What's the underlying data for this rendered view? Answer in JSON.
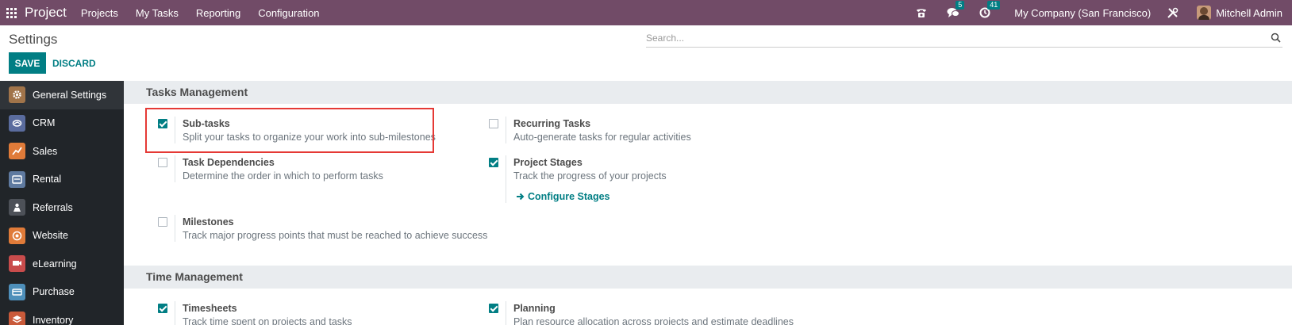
{
  "navbar": {
    "app_name": "Project",
    "menu": [
      "Projects",
      "My Tasks",
      "Reporting",
      "Configuration"
    ],
    "messages_count": "5",
    "activities_count": "41",
    "company": "My Company (San Francisco)",
    "user": "Mitchell Admin",
    "color": "#714b67"
  },
  "control": {
    "title": "Settings",
    "search_placeholder": "Search...",
    "save_label": "SAVE",
    "discard_label": "DISCARD",
    "accent": "#017e84"
  },
  "sidebar": {
    "items": [
      {
        "label": "General Settings",
        "icon": "gear-icon",
        "color": "#a1744a"
      },
      {
        "label": "CRM",
        "icon": "handshake-icon",
        "color": "#5a6c9e"
      },
      {
        "label": "Sales",
        "icon": "chart-icon",
        "color": "#e07b39"
      },
      {
        "label": "Rental",
        "icon": "rental-icon",
        "color": "#5f7aa0"
      },
      {
        "label": "Referrals",
        "icon": "referrals-icon",
        "color": "#4d5158"
      },
      {
        "label": "Website",
        "icon": "globe-icon",
        "color": "#e07b39"
      },
      {
        "label": "eLearning",
        "icon": "elearning-icon",
        "color": "#c94c4c"
      },
      {
        "label": "Purchase",
        "icon": "purchase-icon",
        "color": "#4e8fba"
      },
      {
        "label": "Inventory",
        "icon": "inventory-icon",
        "color": "#c95a3a"
      }
    ]
  },
  "sections": {
    "tasks": {
      "title": "Tasks Management",
      "subtasks": {
        "title": "Sub-tasks",
        "desc": "Split your tasks to organize your work into sub-milestones",
        "checked": true
      },
      "recurring": {
        "title": "Recurring Tasks",
        "desc": "Auto-generate tasks for regular activities",
        "checked": false
      },
      "dependencies": {
        "title": "Task Dependencies",
        "desc": "Determine the order in which to perform tasks",
        "checked": false
      },
      "stages": {
        "title": "Project Stages",
        "desc": "Track the progress of your projects",
        "checked": true,
        "link": "Configure Stages"
      },
      "milestones": {
        "title": "Milestones",
        "desc": "Track major progress points that must be reached to achieve success",
        "checked": false
      }
    },
    "time": {
      "title": "Time Management",
      "timesheets": {
        "title": "Timesheets",
        "desc": "Track time spent on projects and tasks",
        "checked": true
      },
      "planning": {
        "title": "Planning",
        "desc": "Plan resource allocation across projects and estimate deadlines",
        "checked": true
      }
    }
  },
  "highlight_color": "#e53935"
}
